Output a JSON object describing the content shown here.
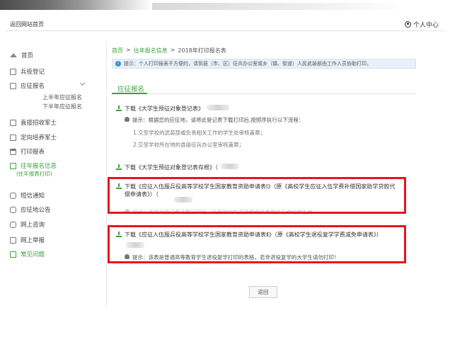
{
  "topbar": {
    "back_link": "返回网站首页",
    "user_center": "个人中心"
  },
  "sidebar": {
    "items": [
      {
        "label": "首页",
        "icon": "home-icon"
      },
      {
        "label": "兵役登记",
        "icon": "register-icon"
      },
      {
        "label": "应征报名",
        "icon": "form-icon"
      },
      {
        "label": "直接招收军士",
        "icon": "doc-icon"
      },
      {
        "label": "定向培养军士",
        "icon": "doc-icon"
      },
      {
        "label": "打印报表",
        "icon": "printer-icon"
      },
      {
        "label": "往年报名信息",
        "icon": "history-icon"
      },
      {
        "label": "短信通知",
        "icon": "message-icon"
      },
      {
        "label": "应征地公告",
        "icon": "notice-icon"
      },
      {
        "label": "网上咨询",
        "icon": "chat-icon"
      },
      {
        "label": "网上举报",
        "icon": "report-icon"
      },
      {
        "label": "常见问题",
        "icon": "question-icon"
      }
    ],
    "sub_items": [
      "上半年应征报名",
      "下半年应征报名"
    ],
    "active_sub": "(往年报表打印)"
  },
  "breadcrumb": {
    "home": "首页",
    "sep": ">",
    "parent": "往年报名信息",
    "current": "2018年打印报名表"
  },
  "notice": {
    "text": "提示：个人打印报表不方便的，请到县（市、区）征兵办公室或乡（镇、街道）人民武装部由工作人员协助打印。"
  },
  "tab": {
    "label": "应征报名"
  },
  "downloads": [
    {
      "label": "下载《大学生预征对象登记表》",
      "tip": "提示：根据您的应征地，请将此登记表下载打印后,按照序执行以下流程：",
      "steps": [
        "1.交至学校的武装部或负责相关工作的学生处审核盖章；",
        "2.交至学校所在地的县级征兵办公室审核盖章；"
      ]
    },
    {
      "label": "下载《大学生预征对象登记表存根》（"
    },
    {
      "label": "下载《应征入伍服兵役高等学校学生国家教育资助申请表Ⅰ》（原《高校学生应征入伍学费补偿国家助学贷款代偿申请表》）（",
      "tip": "提示：请将此登记表下载打印后，交至学校的武装部或负责相关工作的学生处"
    },
    {
      "label": "下载《应征入伍服兵役高等学校学生国家教育资助申请表Ⅱ》（原《高校学生退役复学学费减免申请表》）",
      "tip": "提示：该表是普通高等教育学生退役复学打印的表格，若非退役复学的大学生请勿打印！"
    }
  ],
  "back_button": "返回",
  "colors": {
    "accent": "#3aa33a",
    "highlight": "#e6161c",
    "notice_bg": "#e8f1fa"
  }
}
